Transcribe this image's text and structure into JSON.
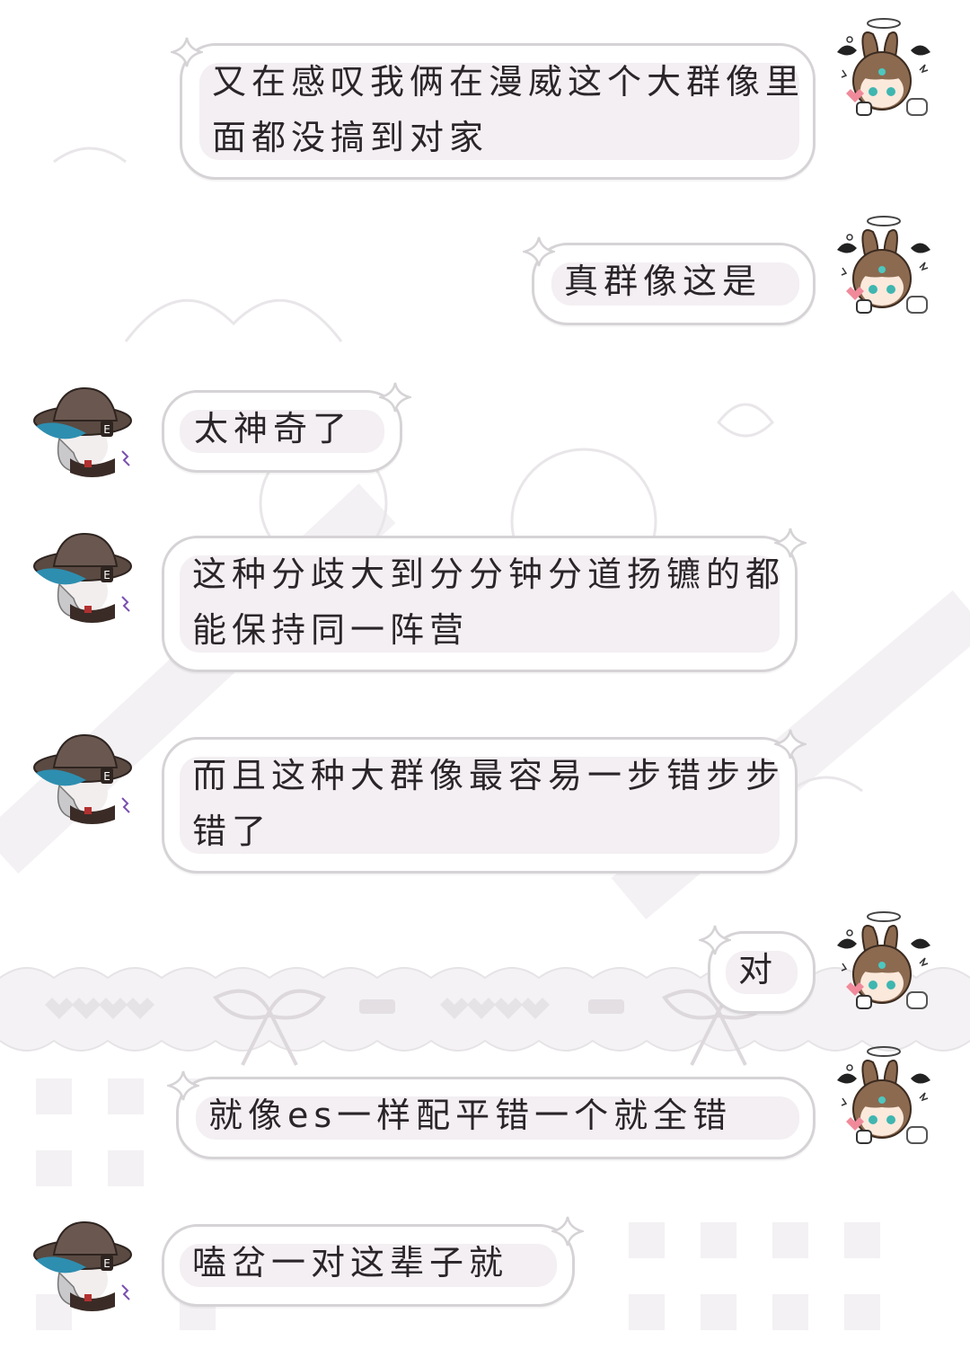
{
  "messages": [
    {
      "side": "right",
      "text": "又在感叹我俩在漫威这个大群像里面都没搞到对家"
    },
    {
      "side": "right",
      "text": "真群像这是"
    },
    {
      "side": "left",
      "text": "太神奇了"
    },
    {
      "side": "left",
      "text": "这种分歧大到分分钟分道扬镳的都能保持同一阵营"
    },
    {
      "side": "left",
      "text": "而且这种大群像最容易一步错步步错了"
    },
    {
      "side": "right",
      "text": "对"
    },
    {
      "side": "right",
      "text": "就像es一样配平错一个就全错"
    },
    {
      "side": "left",
      "text": "嗑岔一对这辈子就"
    }
  ],
  "avatars": {
    "right": {
      "icon": "bunny-girl-avatar-icon"
    },
    "left": {
      "icon": "hat-boy-avatar-icon"
    }
  },
  "colors": {
    "bubble_border": "#d6d3d6",
    "bubble_fill": "#ffffff",
    "text_highlight": "#f3eff2",
    "text": "#2a2528",
    "background_pattern": "#e6e3e6"
  }
}
